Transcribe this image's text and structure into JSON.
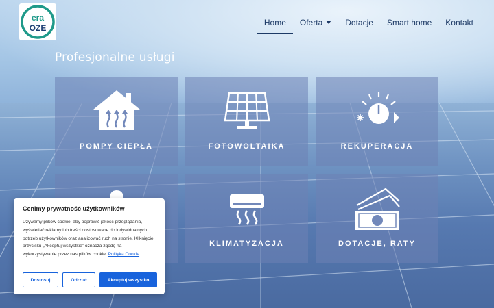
{
  "logo": {
    "line1": "era",
    "line2": "OZE"
  },
  "nav": {
    "items": [
      {
        "label": "Home"
      },
      {
        "label": "Oferta"
      },
      {
        "label": "Dotacje"
      },
      {
        "label": "Smart home"
      },
      {
        "label": "Kontakt"
      }
    ],
    "active": "Home"
  },
  "section": {
    "title": "Profesjonalne usługi"
  },
  "tiles": [
    {
      "label": "POMPY CIEPŁA",
      "icon": "heat-pump-house-icon"
    },
    {
      "label": "FOTOWOLTAIKA",
      "icon": "solar-panel-icon"
    },
    {
      "label": "REKUPERACJA",
      "icon": "recuperation-icon"
    },
    {
      "label": "",
      "icon": "worker-helmet-icon"
    },
    {
      "label": "KLIMATYZACJA",
      "icon": "air-conditioner-icon"
    },
    {
      "label": "DOTACJE, RATY",
      "icon": "money-stack-icon"
    }
  ],
  "cookie": {
    "title": "Cenimy prywatność użytkowników",
    "text": "Używamy plików cookie, aby poprawić jakość przeglądania, wyświetlać reklamy lub treści dostosowane do indywidualnych potrzeb użytkowników oraz analizować ruch na stronie. Kliknięcie przycisku „Akceptuj wszystkie” oznacza zgodę na wykorzystywanie przez nas plików cookie.",
    "link": "Polityka Cookie",
    "buttons": {
      "customize": "Dostosuj",
      "reject": "Odrzuć",
      "accept": "Akceptuj wszystko"
    }
  },
  "colors": {
    "brand_blue": "#1863dc",
    "nav_text": "#1d3a66",
    "logo_green": "#1f9a8a",
    "logo_navy": "#1d3f73"
  }
}
